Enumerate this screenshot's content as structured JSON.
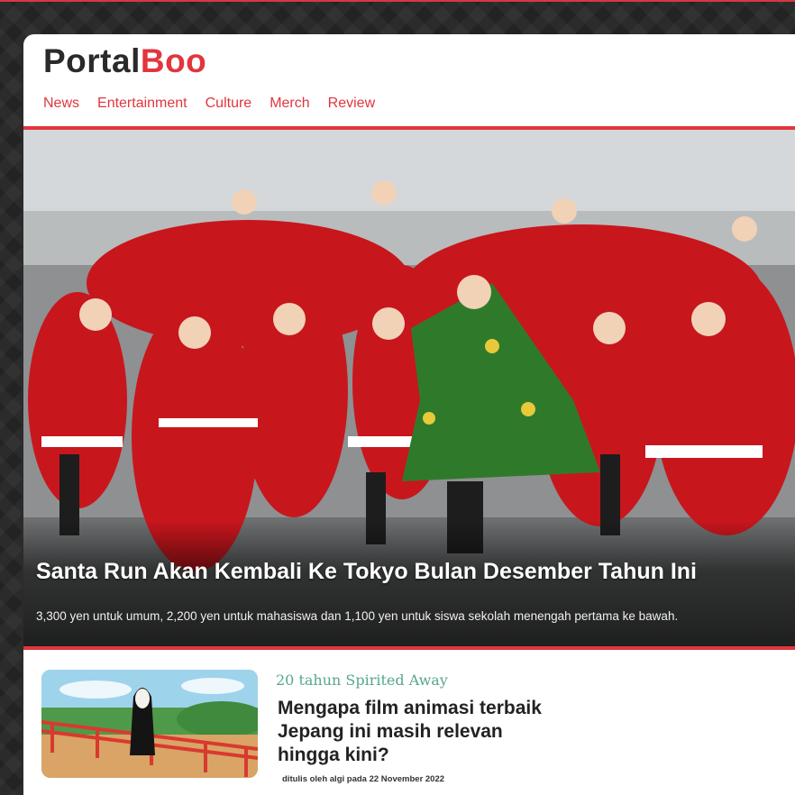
{
  "site": {
    "logo_part1": "Portal",
    "logo_part2": "Boo"
  },
  "nav": {
    "items": [
      "News",
      "Entertainment",
      "Culture",
      "Merch",
      "Review"
    ]
  },
  "hero": {
    "title": "Santa Run Akan Kembali Ke Tokyo Bulan Desember Tahun Ini",
    "subtitle": "3,300 yen untuk umum, 2,200 yen untuk mahasiswa dan 1,100 yen untuk siswa sekolah menengah pertama ke bawah."
  },
  "article": {
    "kicker": "20 tahun Spirited Away",
    "title": "Mengapa film animasi terbaik Jepang ini masih relevan hingga kini?",
    "byline": "ditulis oleh algi pada 22 November 2022"
  },
  "colors": {
    "accent": "#e2353d",
    "kicker": "#57a889",
    "background": "#2b2b2b"
  }
}
